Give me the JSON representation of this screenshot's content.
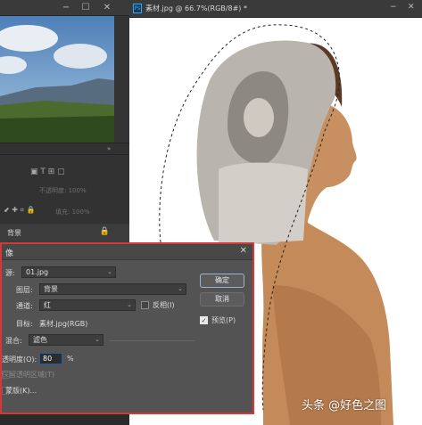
{
  "document": {
    "tab_title": "素材.jpg @ 66.7%(RGB/8#)",
    "tab_modified": "*",
    "app_icon": "Ps"
  },
  "layers_panel": {
    "row1_text": "不透明度: 100%",
    "row2_text": "填充: 100%",
    "layer_name": "背景"
  },
  "dialog": {
    "title": "像",
    "source_label": "源:",
    "source_value": "01.jpg",
    "layer_label": "图层:",
    "layer_value": "背景",
    "channel_label": "通道:",
    "channel_value": "红",
    "invert_label": "反相(I)",
    "target_label": "目标:",
    "target_value": "素材.jpg(RGB)",
    "blending_label": "混合:",
    "blending_value": "滤色",
    "opacity_label": "透明度(O):",
    "opacity_value": "80",
    "opacity_unit": "%",
    "preserve_label": "保留透明区域(T)",
    "mask_label": "蒙版(K)...",
    "ok_label": "确定",
    "cancel_label": "取消",
    "preview_label": "预览(P)",
    "preview_checked": true,
    "invert_checked": false
  },
  "watermark": "头条 @好色之图",
  "colors": {
    "dialog_border": "#d23a3a",
    "panel_bg": "#333333",
    "dialog_bg": "#535353",
    "accent_blue": "#31a8ff"
  }
}
